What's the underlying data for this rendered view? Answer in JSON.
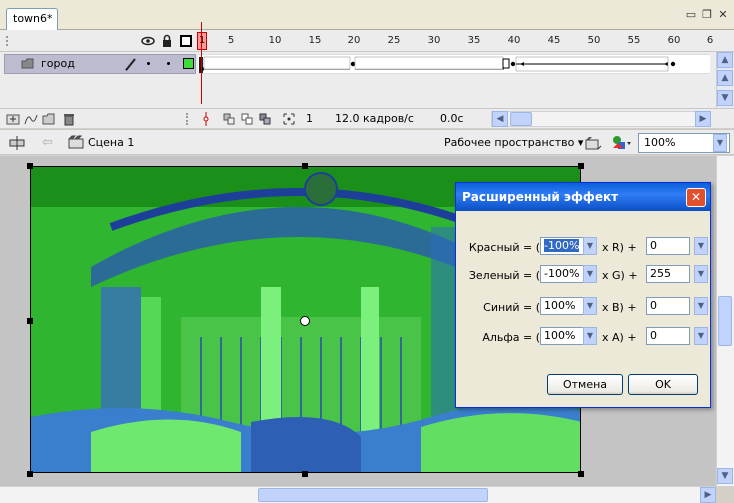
{
  "document_tab": {
    "label": "town6*"
  },
  "window_buttons": {
    "restore": "▭",
    "maximize": "❐",
    "close": "✕"
  },
  "timeline": {
    "frame_numbers": [
      "1",
      "5",
      "10",
      "15",
      "20",
      "25",
      "30",
      "35",
      "40",
      "45",
      "50",
      "55",
      "60",
      "6"
    ],
    "layer_name": "город",
    "status": {
      "current_frame": "1",
      "frame_rate": "12.0 кадров/с",
      "elapsed": "0.0с"
    }
  },
  "scenebar": {
    "scene_label": "Сцена 1",
    "workspace_label": "Рабочее пространство",
    "zoom": "100%"
  },
  "dialog": {
    "title": "Расширенный эффект",
    "rows": [
      {
        "label": "Красный = (",
        "percent": "-100%",
        "channel": "x R) +",
        "offset": "0"
      },
      {
        "label": "Зеленый = (",
        "percent": "-100%",
        "channel": "x G) +",
        "offset": "255"
      },
      {
        "label": "Синий = (",
        "percent": "100%",
        "channel": "x B) +",
        "offset": "0"
      },
      {
        "label": "Альфа = (",
        "percent": "100%",
        "channel": "x A) +",
        "offset": "0"
      }
    ],
    "cancel_label": "Отмена",
    "ok_label": "OK"
  },
  "colors": {
    "image_green": "#2ab32a",
    "dialog_title": "#0a5fd8",
    "playhead": "#d00000"
  }
}
